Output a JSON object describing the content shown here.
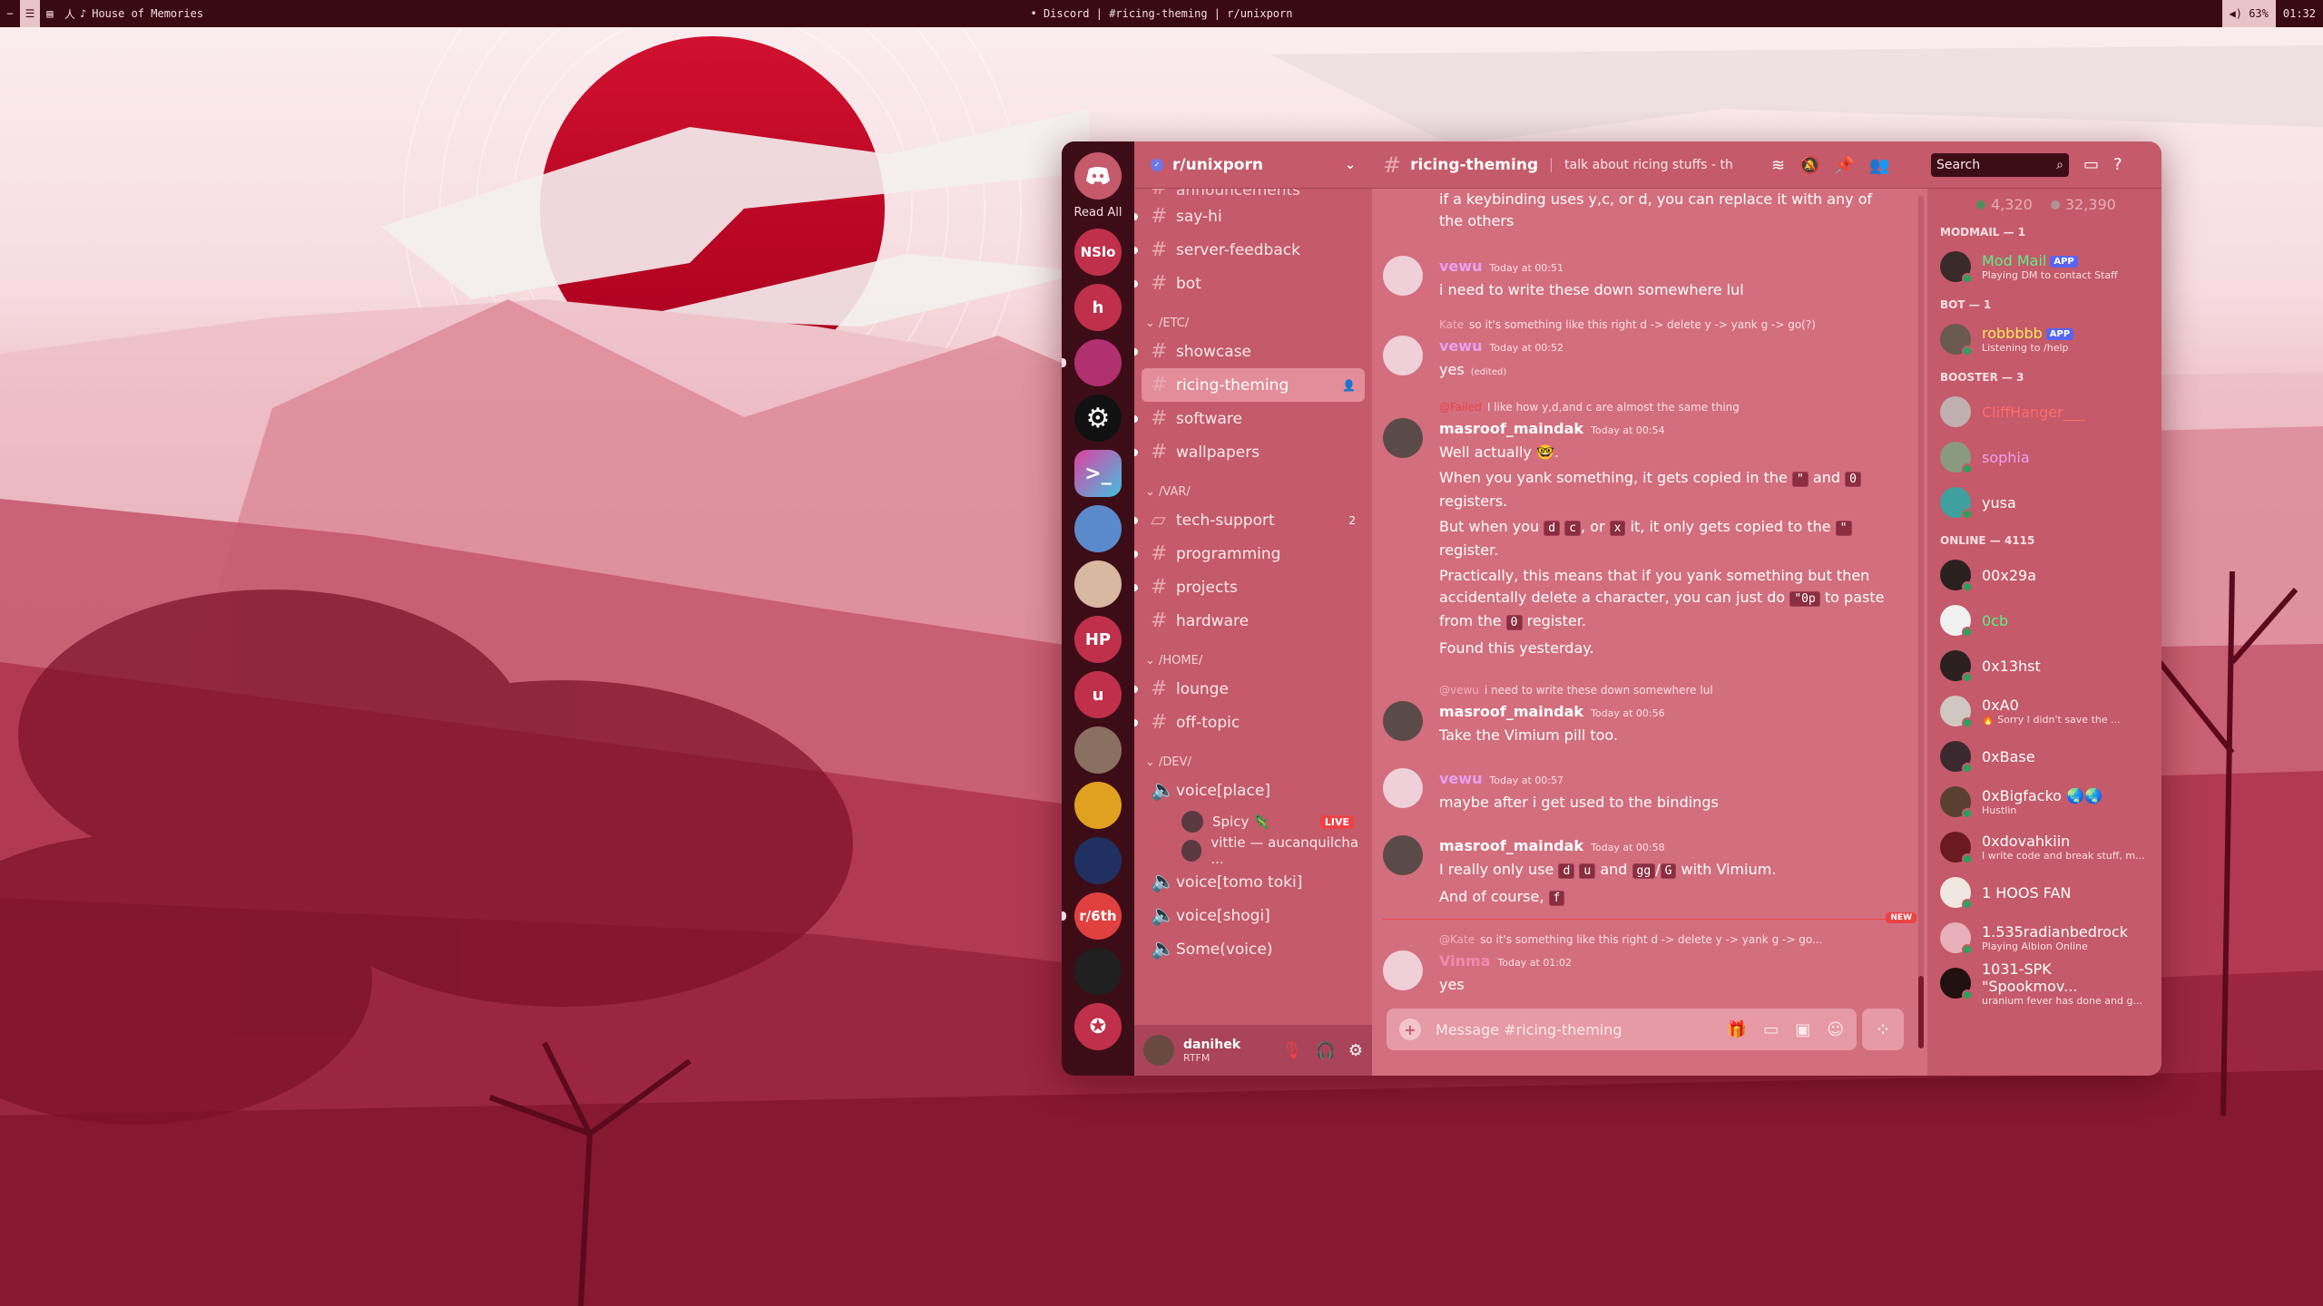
{
  "topbar": {
    "left_title": "House of Memories",
    "center_title": "• Discord | #ricing-theming | r/unixporn",
    "battery": "63%",
    "clock": "01:32"
  },
  "guilds": {
    "read_all": "Read All",
    "items": [
      {
        "label": "NSlo",
        "color": "#c0304a"
      },
      {
        "label": "h",
        "color": "#c0304a"
      },
      {
        "label": "",
        "color": "#b03070"
      },
      {
        "label": "",
        "color": "#111111"
      },
      {
        "label": "",
        "color": "#2a3a6a"
      },
      {
        "label": "",
        "color": "#5a8acc"
      },
      {
        "label": "",
        "color": "#d8b8a0"
      },
      {
        "label": "HP",
        "color": "#c0304a"
      },
      {
        "label": "u",
        "color": "#c0304a"
      },
      {
        "label": "",
        "color": "#8a7060"
      },
      {
        "label": "",
        "color": "#e0a020"
      },
      {
        "label": "",
        "color": "#203060"
      },
      {
        "label": "r/6th",
        "color": "#e04040"
      },
      {
        "label": "",
        "color": "#202020"
      },
      {
        "label": "",
        "color": "#c0304a"
      }
    ]
  },
  "server": {
    "name": "r/unixporn"
  },
  "channels": {
    "top": [
      {
        "name": "announcements"
      },
      {
        "name": "say-hi"
      },
      {
        "name": "server-feedback"
      },
      {
        "name": "bot"
      }
    ],
    "cat_etc": "/ETC/",
    "etc": [
      {
        "name": "showcase"
      },
      {
        "name": "ricing-theming"
      },
      {
        "name": "software"
      },
      {
        "name": "wallpapers"
      }
    ],
    "cat_var": "/VAR/",
    "var": [
      {
        "name": "tech-support",
        "count": "2"
      },
      {
        "name": "programming"
      },
      {
        "name": "projects"
      },
      {
        "name": "hardware"
      }
    ],
    "cat_home": "/HOME/",
    "home": [
      {
        "name": "lounge"
      },
      {
        "name": "off-topic"
      }
    ],
    "cat_dev": "/DEV/",
    "voice1": "voice[place]",
    "vc_users": [
      {
        "name": "Spicy 🦎",
        "live": "LIVE"
      },
      {
        "name": "vittie — aucanquilcha ..."
      }
    ],
    "voice2": "voice[tomo toki]",
    "voice3": "voice[shogi]",
    "voice4": "Some(voice)"
  },
  "user_panel": {
    "name": "danihek",
    "status": "RTFM"
  },
  "chat": {
    "channel": "ricing-theming",
    "topic": "talk about ricing stuffs - this ch...",
    "search_placeholder": "Search",
    "composer_placeholder": "Message #ricing-theming",
    "new_label": "NEW",
    "messages": {
      "m0_l1": "if a keybinding uses y,c, or d, you can replace it with any of",
      "m0_l2": "the others",
      "m1_author": "vewu",
      "m1_ts": "Today at 00:51",
      "m1_text": "i need to write these down somewhere lul",
      "r2_name": "Kate",
      "r2_text": "so it's something like this right d -> delete y -> yank g -> go(?)",
      "m2_author": "vewu",
      "m2_ts": "Today at 00:52",
      "m2_text": "yes",
      "m2_edited": "(edited)",
      "r3_name": "@Failed",
      "r3_text": "I like how y,d,and c are almost the same thing",
      "m3_author": "masroof_maindak",
      "m3_ts": "Today at 00:54",
      "m3_text": "Well actually 🤓.",
      "m3_c1a": "When you yank something, it gets copied in the",
      "m3_c1b": "and",
      "m3_c1c": "registers.",
      "m3_c2a": "But when you",
      "m3_c2b": "or",
      "m3_c2c": "it, it only gets copied to the",
      "m3_c2d": "register.",
      "m3_c3a": "Practically, this means that if you yank something but then",
      "m3_c3b": "accidentally delete a character, you can just do",
      "m3_c3c": "to paste",
      "m3_c3d": "from the",
      "m3_c3e": "register.",
      "m3_c4": "Found this yesterday.",
      "k_quote": "\"",
      "k_zero": "0",
      "k_d": "d",
      "k_c": "c",
      "k_x": "x",
      "k_paste": "\"0p",
      "r4_name": "@vewu",
      "r4_text": "i need to write these down somewhere lul",
      "m4_author": "masroof_maindak",
      "m4_ts": "Today at 00:56",
      "m4_text": "Take the Vimium pill too.",
      "m5_author": "vewu",
      "m5_ts": "Today at 00:57",
      "m5_text": "maybe after i get used to the bindings",
      "m6_author": "masroof_maindak",
      "m6_ts": "Today at 00:58",
      "m6_a": "I really only use",
      "m6_b": "and",
      "m6_c": "with Vimium.",
      "m6_d": "And of course,",
      "k_u": "u",
      "k_gg": "gg",
      "k_G": "G",
      "k_f": "f",
      "r7_name": "@Kate",
      "r7_text": "so it's something like this right d -> delete y -> yank g -> go...",
      "m7_author": "Vinma",
      "m7_ts": "Today at 01:02",
      "m7_text": "yes"
    }
  },
  "members": {
    "online_count": "4,320",
    "total_count": "32,390",
    "cat_modmail": "MODMAIL — 1",
    "modmail": {
      "name": "Mod Mail",
      "badge": "APP",
      "sub": "Playing DM to contact Staff"
    },
    "cat_bot": "BOT — 1",
    "bot": {
      "name": "robbbbb",
      "badge": "APP",
      "sub": "Listening to /help"
    },
    "cat_booster": "BOOSTER — 3",
    "boosters": [
      {
        "name": "CliffHanger___"
      },
      {
        "name": "sophia"
      },
      {
        "name": "yusa"
      }
    ],
    "cat_online": "ONLINE — 4115",
    "online": [
      {
        "name": "00x29a",
        "sub": ""
      },
      {
        "name": "0cb",
        "sub": ""
      },
      {
        "name": "0x13hst",
        "sub": ""
      },
      {
        "name": "0xA0",
        "sub": "🔥 Sorry I didn't save the ..."
      },
      {
        "name": "0xBase",
        "sub": ""
      },
      {
        "name": "0xBigfacko 🌏🌏",
        "sub": "Hustlin"
      },
      {
        "name": "0xdovahkiin",
        "sub": "I write code and break stuff, m..."
      },
      {
        "name": "1 HOOS FAN",
        "sub": ""
      },
      {
        "name": "1.535radianbedrock",
        "sub": "Playing Albion Online"
      },
      {
        "name": "1031-SPK \"Spookmov...",
        "sub": "uranium fever has done and g..."
      }
    ]
  },
  "colors": {
    "accent": "#c45a6a",
    "dark": "#3d0d17",
    "sun": "#c8102e"
  }
}
